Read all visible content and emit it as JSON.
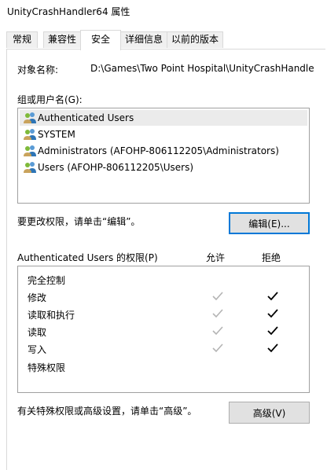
{
  "window": {
    "title": "UnityCrashHandler64 属性"
  },
  "tabs": [
    {
      "label": "常规",
      "active": false
    },
    {
      "label": "兼容性",
      "active": false
    },
    {
      "label": "安全",
      "active": true
    },
    {
      "label": "详细信息",
      "active": false
    },
    {
      "label": "以前的版本",
      "active": false
    }
  ],
  "object": {
    "label": "对象名称:",
    "value": "D:\\Games\\Two Point Hospital\\UnityCrashHandle"
  },
  "groups": {
    "label": "组或用户名(G):",
    "items": [
      {
        "label": "Authenticated Users",
        "selected": true
      },
      {
        "label": "SYSTEM",
        "selected": false
      },
      {
        "label": "Administrators (AFOHP-806112205\\Administrators)",
        "selected": false
      },
      {
        "label": "Users (AFOHP-806112205\\Users)",
        "selected": false
      }
    ],
    "icon": "users-group-icon"
  },
  "edit": {
    "hint": "要更改权限，请单击“编辑”。",
    "button_label": "编辑(E)..."
  },
  "permissions": {
    "title": "Authenticated Users 的权限(P)",
    "allow_header": "允许",
    "deny_header": "拒绝",
    "rows": [
      {
        "name": "完全控制",
        "allow": false,
        "deny": false
      },
      {
        "name": "修改",
        "allow": true,
        "deny": true
      },
      {
        "name": "读取和执行",
        "allow": true,
        "deny": true
      },
      {
        "name": "读取",
        "allow": true,
        "deny": true
      },
      {
        "name": "写入",
        "allow": true,
        "deny": true
      },
      {
        "name": "特殊权限",
        "allow": false,
        "deny": false
      }
    ],
    "allow_check_color": "#b4b4b4",
    "deny_check_color": "#000000"
  },
  "advanced": {
    "hint": "有关特殊权限或高级设置，请单击“高级”。",
    "button_label": "高级(V)"
  }
}
